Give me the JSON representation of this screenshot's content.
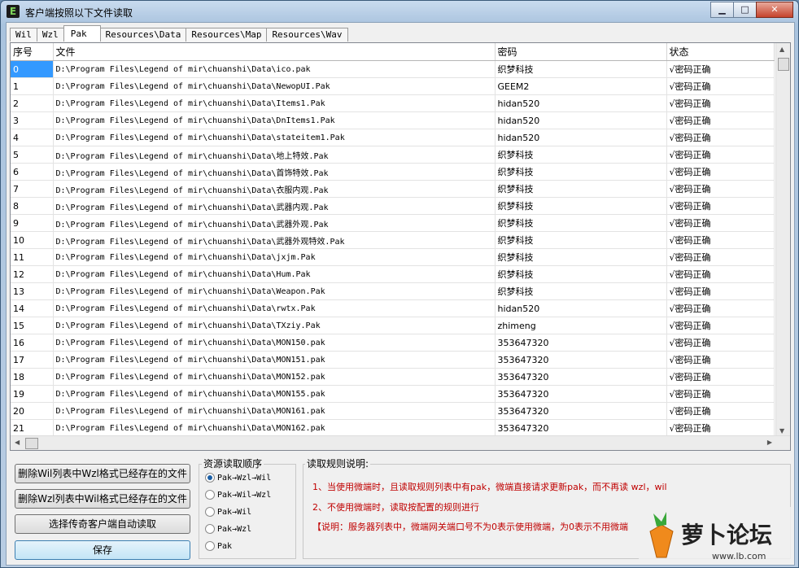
{
  "window": {
    "title": "客户端按照以下文件读取",
    "min_label": "▁",
    "max_label": "□",
    "close_label": "✕"
  },
  "tabs": [
    "Wil",
    "Wzl",
    "Pak",
    "Resources\\Data",
    "Resources\\Map",
    "Resources\\Wav"
  ],
  "active_tab": "Pak",
  "table": {
    "headers": [
      "序号",
      "文件",
      "密码",
      "状态"
    ],
    "rows": [
      [
        "0",
        "D:\\Program Files\\Legend of mir\\chuanshi\\Data\\ico.pak",
        "织梦科技",
        "√密码正确"
      ],
      [
        "1",
        "D:\\Program Files\\Legend of mir\\chuanshi\\Data\\NewopUI.Pak",
        "GEEM2",
        "√密码正确"
      ],
      [
        "2",
        "D:\\Program Files\\Legend of mir\\chuanshi\\Data\\Items1.Pak",
        "hidan520",
        "√密码正确"
      ],
      [
        "3",
        "D:\\Program Files\\Legend of mir\\chuanshi\\Data\\DnItems1.Pak",
        "hidan520",
        "√密码正确"
      ],
      [
        "4",
        "D:\\Program Files\\Legend of mir\\chuanshi\\Data\\stateitem1.Pak",
        "hidan520",
        "√密码正确"
      ],
      [
        "5",
        "D:\\Program Files\\Legend of mir\\chuanshi\\Data\\地上特效.Pak",
        "织梦科技",
        "√密码正确"
      ],
      [
        "6",
        "D:\\Program Files\\Legend of mir\\chuanshi\\Data\\首饰特效.Pak",
        "织梦科技",
        "√密码正确"
      ],
      [
        "7",
        "D:\\Program Files\\Legend of mir\\chuanshi\\Data\\衣服内观.Pak",
        "织梦科技",
        "√密码正确"
      ],
      [
        "8",
        "D:\\Program Files\\Legend of mir\\chuanshi\\Data\\武器内观.Pak",
        "织梦科技",
        "√密码正确"
      ],
      [
        "9",
        "D:\\Program Files\\Legend of mir\\chuanshi\\Data\\武器外观.Pak",
        "织梦科技",
        "√密码正确"
      ],
      [
        "10",
        "D:\\Program Files\\Legend of mir\\chuanshi\\Data\\武器外观特效.Pak",
        "织梦科技",
        "√密码正确"
      ],
      [
        "11",
        "D:\\Program Files\\Legend of mir\\chuanshi\\Data\\jxjm.Pak",
        "织梦科技",
        "√密码正确"
      ],
      [
        "12",
        "D:\\Program Files\\Legend of mir\\chuanshi\\Data\\Hum.Pak",
        "织梦科技",
        "√密码正确"
      ],
      [
        "13",
        "D:\\Program Files\\Legend of mir\\chuanshi\\Data\\Weapon.Pak",
        "织梦科技",
        "√密码正确"
      ],
      [
        "14",
        "D:\\Program Files\\Legend of mir\\chuanshi\\Data\\rwtx.Pak",
        "hidan520",
        "√密码正确"
      ],
      [
        "15",
        "D:\\Program Files\\Legend of mir\\chuanshi\\Data\\TXziy.Pak",
        "zhimeng",
        "√密码正确"
      ],
      [
        "16",
        "D:\\Program Files\\Legend of mir\\chuanshi\\Data\\MON150.pak",
        "353647320",
        "√密码正确"
      ],
      [
        "17",
        "D:\\Program Files\\Legend of mir\\chuanshi\\Data\\MON151.pak",
        "353647320",
        "√密码正确"
      ],
      [
        "18",
        "D:\\Program Files\\Legend of mir\\chuanshi\\Data\\MON152.pak",
        "353647320",
        "√密码正确"
      ],
      [
        "19",
        "D:\\Program Files\\Legend of mir\\chuanshi\\Data\\MON155.pak",
        "353647320",
        "√密码正确"
      ],
      [
        "20",
        "D:\\Program Files\\Legend of mir\\chuanshi\\Data\\MON161.pak",
        "353647320",
        "√密码正确"
      ],
      [
        "21",
        "D:\\Program Files\\Legend of mir\\chuanshi\\Data\\MON162.pak",
        "353647320",
        "√密码正确"
      ]
    ]
  },
  "buttons": {
    "delete_wzl": "删除Wil列表中Wzl格式已经存在的文件",
    "delete_wil": "删除Wzl列表中Wil格式已经存在的文件",
    "auto_read": "选择传奇客户端自动读取",
    "save": "保存"
  },
  "order": {
    "label": "资源读取顺序",
    "options": [
      "Pak→Wzl→Wil",
      "Pak→Wil→Wzl",
      "Pak→Wil",
      "Pak→Wzl",
      "Pak"
    ],
    "selected": "Pak→Wzl→Wil"
  },
  "rules": {
    "label": "读取规则说明:",
    "lines": [
      "1、当使用微端时，且读取规则列表中有pak，微端直接请求更新pak，而不再读 wzl，wil",
      "2、不使用微端时，读取按配置的规则进行",
      "【说明：服务器列表中，微端网关端口号不为0表示使用微端，为0表示不用微端"
    ]
  },
  "watermark": {
    "text": "萝卜论坛",
    "url": "www.lb.com"
  },
  "colors": {
    "selection": "#3399ff",
    "rule_text": "#c00000"
  }
}
